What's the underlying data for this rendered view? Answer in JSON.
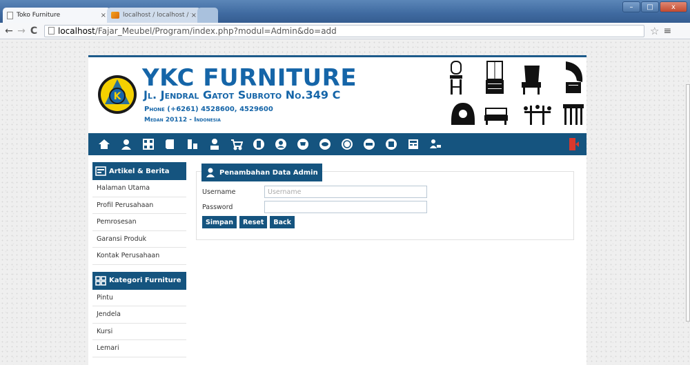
{
  "browser": {
    "tabs": [
      {
        "title": "Toko Furniture",
        "close": "×"
      },
      {
        "title": "localhost / localhost / faz",
        "close": "×"
      }
    ],
    "url": {
      "host": "localhost",
      "path": "/Fajar_Meubel/Program/index.php?modul=Admin&do=add"
    },
    "window_buttons": {
      "minimize": "–",
      "maximize": "□",
      "close": "x"
    }
  },
  "header": {
    "brand": "YKC FURNITURE",
    "address": "Jl. Jendral Gatot Subroto No.349 C",
    "phone": "Phone (+6261) 4528600, 4529600",
    "postal": "Medan 20112 - Indonesia",
    "logo_letter": "K"
  },
  "sidebar": {
    "section1": {
      "title": "Artikel & Berita",
      "items": [
        "Halaman Utama",
        "Profil Perusahaan",
        "Pemrosesan",
        "Garansi Produk",
        "Kontak Perusahaan"
      ]
    },
    "section2": {
      "title": "Kategori Furniture",
      "items": [
        "Pintu",
        "Jendela",
        "Kursi",
        "Lemari"
      ]
    }
  },
  "form": {
    "title": "Penambahan Data Admin",
    "username_label": "Username",
    "username_placeholder": "Username",
    "password_label": "Password",
    "save_label": "Simpan",
    "reset_label": "Reset",
    "back_label": "Back"
  },
  "colors": {
    "brand": "#1565a8",
    "nav_bar": "#15547f"
  }
}
